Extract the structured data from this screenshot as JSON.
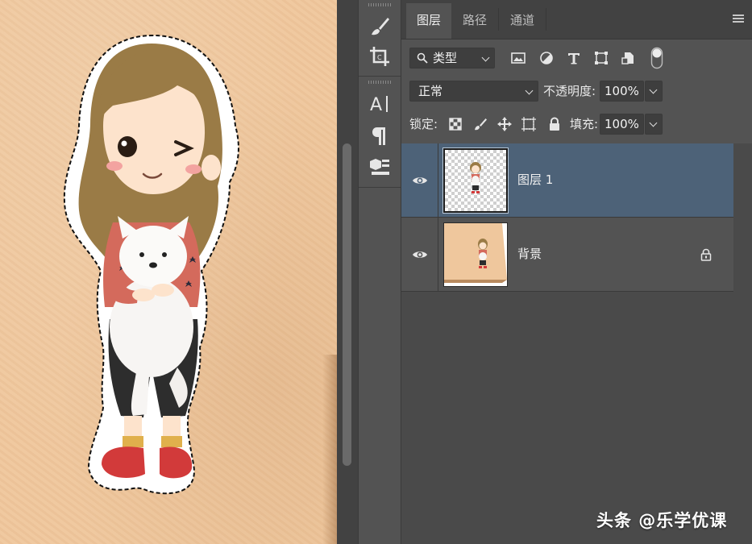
{
  "panel": {
    "tabs": [
      {
        "label": "图层",
        "active": true
      },
      {
        "label": "路径",
        "active": false
      },
      {
        "label": "通道",
        "active": false
      }
    ],
    "filter": {
      "kind_label": "类型",
      "icons": [
        "image-filter-icon",
        "adjustment-filter-icon",
        "type-filter-icon",
        "shape-filter-icon",
        "smart-object-filter-icon",
        "filter-toggle-icon"
      ]
    },
    "blend_mode": "正常",
    "opacity_label": "不透明度:",
    "opacity_value": "100%",
    "lock_label": "锁定:",
    "fill_label": "填充:",
    "fill_value": "100%",
    "layers": [
      {
        "name": "图层 1",
        "visible": true,
        "selected": true,
        "locked": false
      },
      {
        "name": "背景",
        "visible": true,
        "selected": false,
        "locked": true
      }
    ]
  },
  "tools": [
    "brush-tool-icon",
    "crop-tool-icon",
    "character-icon",
    "paragraph-icon",
    "3d-material-icon"
  ],
  "watermark": "头条 @乐学优课",
  "colors": {
    "canvas": "#efc79d",
    "panel_bg": "#535353",
    "tab_bar": "#424242",
    "selected_layer": "#4d6278"
  }
}
